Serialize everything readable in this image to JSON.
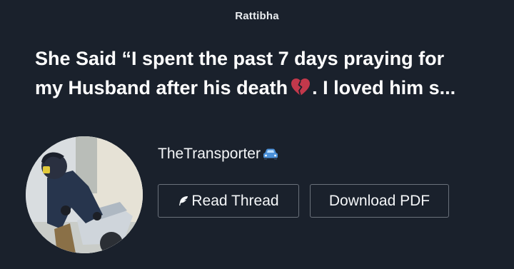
{
  "brand": {
    "name": "Rattibha"
  },
  "thread": {
    "title_line1": "She Said “I spent the past 7 days praying for",
    "title_line2_before": "my Husband after his death",
    "title_icon": "broken-heart-icon",
    "title_line2_after": ". I loved him s..."
  },
  "author": {
    "name": "TheTransporter",
    "badge_icon": "car-icon",
    "avatar_icon": "avatar-photo"
  },
  "actions": {
    "read_icon": "feather-icon",
    "read_label": "Read Thread",
    "download_label": "Download PDF"
  },
  "colors": {
    "background": "#1a212c",
    "text": "#ffffff",
    "button_border": "#6a717b",
    "heart": "#c2384b",
    "car": "#4a90d9"
  }
}
